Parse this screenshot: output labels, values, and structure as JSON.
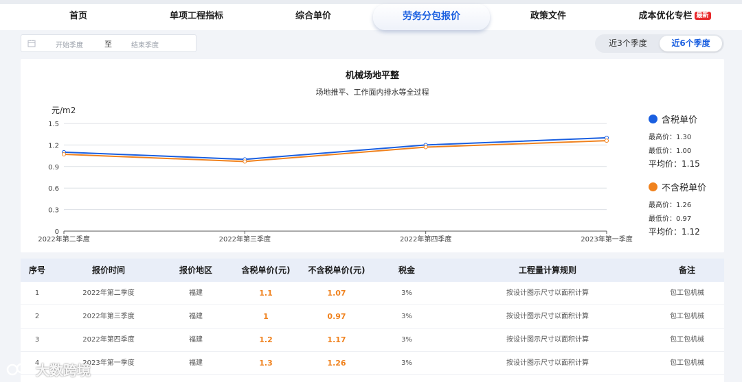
{
  "nav": {
    "items": [
      {
        "label": "首页",
        "active": false
      },
      {
        "label": "单项工程指标",
        "active": false
      },
      {
        "label": "综合单价",
        "active": false
      },
      {
        "label": "劳务分包报价",
        "active": true
      },
      {
        "label": "政策文件",
        "active": false
      },
      {
        "label": "成本优化专栏",
        "active": false,
        "badge": "最新"
      }
    ]
  },
  "date_range": {
    "start_placeholder": "开始季度",
    "separator": "至",
    "end_placeholder": "结束季度"
  },
  "period_toggle": {
    "options": [
      "近3个季度",
      "近6个季度"
    ],
    "selected": "近6个季度"
  },
  "chart": {
    "title": "机械场地平整",
    "subtitle": "场地推平、工作面内排水等全过程",
    "ylabel": "元/m2"
  },
  "legend": [
    {
      "name": "含税单价",
      "color": "#1a5fe0",
      "max_label": "最高价：",
      "max": "1.30",
      "min_label": "最低价：",
      "min": "1.00",
      "avg_label": "平均价：",
      "avg": "1.15"
    },
    {
      "name": "不含税单价",
      "color": "#f0821e",
      "max_label": "最高价：",
      "max": "1.26",
      "min_label": "最低价：",
      "min": "0.97",
      "avg_label": "平均价：",
      "avg": "1.12"
    }
  ],
  "chart_data": {
    "type": "line",
    "title": "机械场地平整",
    "subtitle": "场地推平、工作面内排水等全过程",
    "xlabel": "",
    "ylabel": "元/m2",
    "categories": [
      "2022年第二季度",
      "2022年第三季度",
      "2022年第四季度",
      "2023年第一季度"
    ],
    "ylim": [
      0,
      1.5
    ],
    "yticks": [
      "0",
      "0.3",
      "0.6",
      "0.9",
      "1.2",
      "1.5"
    ],
    "grid": true,
    "legend_position": "right",
    "series": [
      {
        "name": "含税单价",
        "color": "#1a5fe0",
        "values": [
          1.1,
          1.0,
          1.2,
          1.3
        ]
      },
      {
        "name": "不含税单价",
        "color": "#f0821e",
        "values": [
          1.07,
          0.97,
          1.17,
          1.26
        ]
      }
    ]
  },
  "table": {
    "headers": [
      "序号",
      "报价时间",
      "报价地区",
      "含税单价(元)",
      "不含税单价(元)",
      "税金",
      "工程量计算规则",
      "备注"
    ],
    "rows": [
      [
        "1",
        "2022年第二季度",
        "福建",
        "1.1",
        "1.07",
        "3%",
        "按设计图示尺寸以面积计算",
        "包工包机械"
      ],
      [
        "2",
        "2022年第三季度",
        "福建",
        "1",
        "0.97",
        "3%",
        "按设计图示尺寸以面积计算",
        "包工包机械"
      ],
      [
        "3",
        "2022年第四季度",
        "福建",
        "1.2",
        "1.17",
        "3%",
        "按设计图示尺寸以面积计算",
        "包工包机械"
      ],
      [
        "4",
        "2023年第一季度",
        "福建",
        "1.3",
        "1.26",
        "3%",
        "按设计图示尺寸以面积计算",
        "包工包机械"
      ]
    ]
  },
  "watermark": {
    "text": "大数跨境"
  }
}
